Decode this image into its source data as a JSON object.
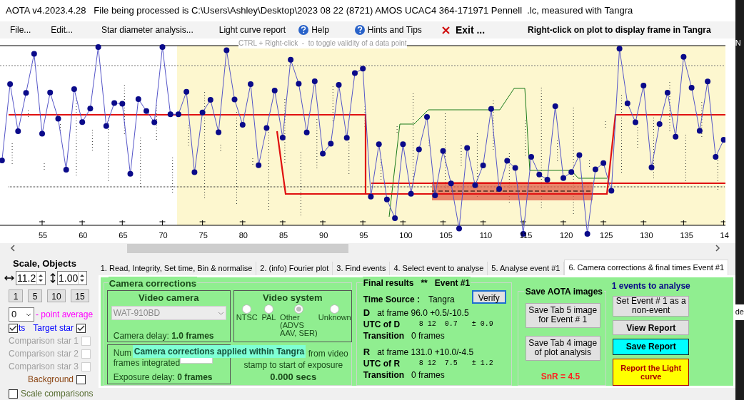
{
  "window": {
    "title": "AOTA v4.2023.4.28   File being processed is C:\\Users\\Ashley\\Desktop\\2023 08 22 (8721) AMOS UCAC4 364-171971 Pennell  .lc, measured with Tangra"
  },
  "menu": [
    {
      "label": "File...",
      "kind": "plain"
    },
    {
      "label": "Edit...",
      "kind": "plain"
    },
    {
      "label": "Star diameter analysis...",
      "kind": "plain"
    },
    {
      "label": "Light curve report",
      "kind": "plain"
    },
    {
      "label": "Help",
      "kind": "help"
    },
    {
      "label": "Hints and Tips",
      "kind": "help"
    },
    {
      "label": "Exit ...",
      "kind": "exit"
    }
  ],
  "plot_hint": "Right-click on plot to display frame in Tangra",
  "toggle_hint": "CTRL + Right-click  -  to toggle validity of a data point",
  "plot": {
    "x_ticks": [
      "55",
      "60",
      "65",
      "70",
      "75",
      "80",
      "85",
      "90",
      "95",
      "100",
      "105",
      "110",
      "115",
      "120",
      "125",
      "130",
      "135",
      "14"
    ]
  },
  "desktop_fragments": [
    "N",
    "de"
  ],
  "scale_objects": {
    "title": "Scale,  Objects",
    "h_scale": "11.2",
    "v_scale": "1.00",
    "scale_buttons": [
      "1",
      "5",
      "10",
      "15"
    ],
    "point_average": "0",
    "point_average_label": "- point average",
    "plots_toggle": {
      "label": "ts",
      "checked": true
    },
    "objects": [
      {
        "label": "Target star",
        "checked": true,
        "disabled": false,
        "color": "#0000ff"
      },
      {
        "label": "Comparison star 1",
        "checked": false,
        "disabled": true,
        "color": "#a0a0a0"
      },
      {
        "label": "Comparison star 2",
        "checked": false,
        "disabled": true,
        "color": "#a0a0a0"
      },
      {
        "label": "Comparison star 3",
        "checked": false,
        "disabled": true,
        "color": "#a0a0a0"
      },
      {
        "label": "Background",
        "checked": false,
        "disabled": false,
        "color": "#8b4513"
      }
    ],
    "scale_comparisons": {
      "label": "Scale comparisons",
      "checked": false
    }
  },
  "tabs": [
    {
      "label": "1.  Read, Integrity, Set time, Bin & normalise",
      "selected": false
    },
    {
      "label": "2. (info)  Fourier plot",
      "selected": false
    },
    {
      "label": "3. Find events",
      "selected": false
    },
    {
      "label": "4. Select event to analyse",
      "selected": false
    },
    {
      "label": "5. Analyse event #1",
      "selected": false
    },
    {
      "label": "6. Camera corrections & final times Event #1",
      "selected": true
    }
  ],
  "camera_corrections": {
    "title": "Camera corrections",
    "video_camera": {
      "title": "Video camera",
      "value": "WAT-910BD",
      "delay_label": "Camera delay:",
      "delay": "1.0 frames"
    },
    "video_system": {
      "title": "Video system",
      "options": [
        {
          "label": "NTSC",
          "selected": false
        },
        {
          "label": "PAL",
          "selected": false
        },
        {
          "label": "Other (ADVS AAV, SER)",
          "selected": true
        },
        {
          "label": "Unknown",
          "selected": false
        }
      ]
    },
    "integration": {
      "label_start": "Num",
      "label_end": "frames integrated",
      "exposure_delay_label": "Exposure delay:",
      "exposure_delay": "0 frames"
    },
    "offset": {
      "text_end": "from video",
      "text_line2": "stamp to start of exposure",
      "value": "0.000 secs"
    },
    "tooltip": "Camera corrections applied within Tangra"
  },
  "final_results": {
    "title": "Final results",
    "stars": "**",
    "event": "Event #1",
    "verify": "Verify",
    "time_source_label": "Time Source :",
    "time_source": "Tangra",
    "events": [
      {
        "letter": "D",
        "frame": "at frame 96.0  +0.5/-10.5",
        "utc_label": "UTC of D",
        "utc": "8 12  0.7",
        "error": "± 0.9",
        "transition_label": "Transition",
        "transition": "0 frames"
      },
      {
        "letter": "R",
        "frame": "at frame 131.0  +10.0/-4.5",
        "utc_label": "UTC of R",
        "utc": "8 12  7.5",
        "error": "± 1.2",
        "transition_label": "Transition",
        "transition": "0 frames"
      }
    ]
  },
  "save_images": {
    "title": "Save AOTA images",
    "buttons": [
      "Save Tab 5 image for Event # 1",
      "Save Tab 4 image of plot analysis"
    ],
    "snr": "SnR = 4.5"
  },
  "actions": {
    "events_label": "1  events to analyse",
    "buttons": [
      {
        "label": "Set Event # 1 as a non-event",
        "kind": "plain"
      },
      {
        "label": "View Report",
        "kind": "bold"
      },
      {
        "label": "Save Report",
        "kind": "cyan"
      },
      {
        "label": "Report the Light curve",
        "kind": "yellow"
      }
    ]
  }
}
